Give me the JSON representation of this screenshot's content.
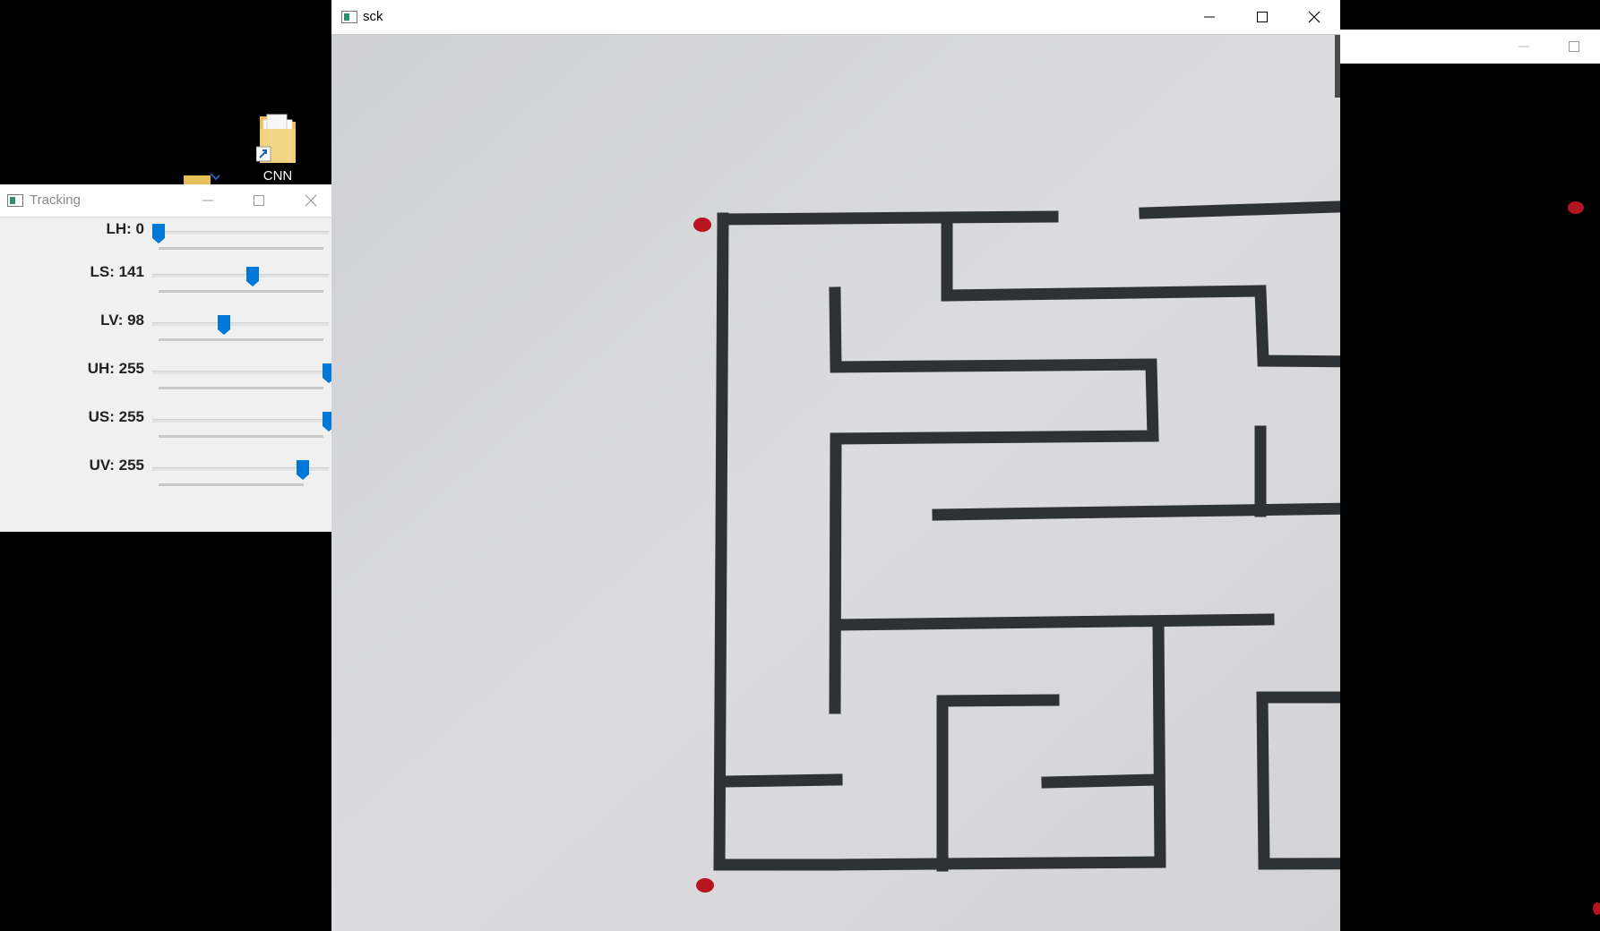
{
  "desktop": {
    "icons": [
      {
        "label": "CNN",
        "icon": "folder-shortcut-icon"
      },
      {
        "label": "",
        "icon": "folder-icon"
      }
    ]
  },
  "tracking_window": {
    "title": "Tracking",
    "sliders": [
      {
        "label": "LH: 0",
        "name": "LH",
        "value": 0,
        "max": 255
      },
      {
        "label": "LS: 141",
        "name": "LS",
        "value": 141,
        "max": 255
      },
      {
        "label": "LV: 98",
        "name": "LV",
        "value": 98,
        "max": 255
      },
      {
        "label": "UH: 255",
        "name": "UH",
        "value": 255,
        "max": 255
      },
      {
        "label": "US: 255",
        "name": "US",
        "value": 255,
        "max": 255
      },
      {
        "label": "UV: 255",
        "name": "UV",
        "value": 255,
        "max": 255
      }
    ]
  },
  "sck_window": {
    "title": "sck",
    "content": "camera-frame-maze"
  },
  "colors": {
    "thumb": "#0078d7",
    "maze_wall": "#2e3234",
    "marker": "#c0151d",
    "paper": "#d6d6d8"
  }
}
